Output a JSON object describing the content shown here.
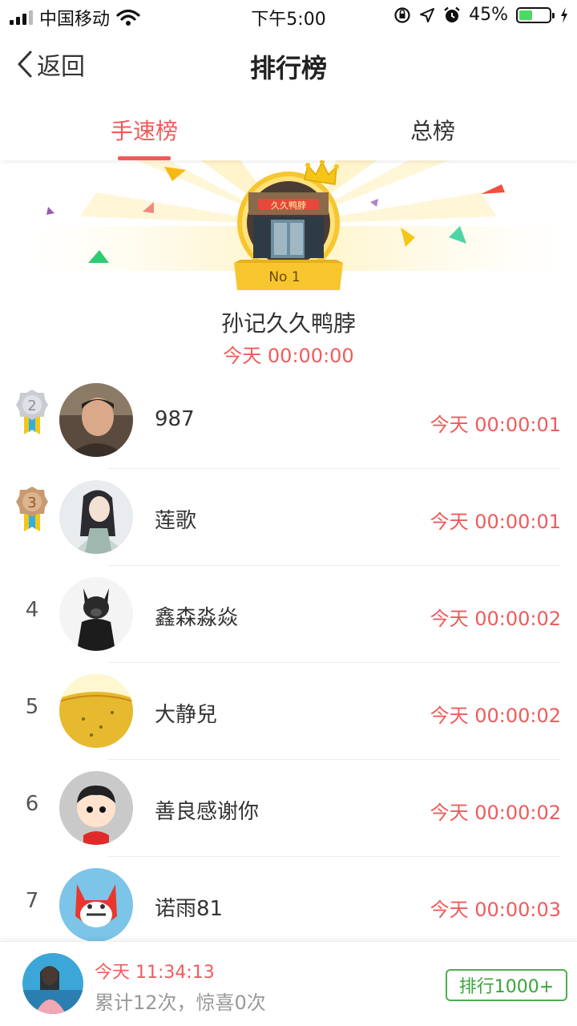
{
  "status_bar": {
    "carrier": "中国移动",
    "time": "下午5:00",
    "battery": "45%",
    "battery_level": 0.45
  },
  "nav": {
    "back_label": "返回",
    "title": "排行榜"
  },
  "tabs": [
    {
      "label": "手速榜",
      "active": true
    },
    {
      "label": "总榜",
      "active": false
    }
  ],
  "champion": {
    "badge": "No 1",
    "shop_sign": "久久鸭脖",
    "name": "孙记久久鸭脖",
    "time": "今天 00:00:00"
  },
  "rankings": [
    {
      "rank": "2",
      "name": "987",
      "time": "今天 00:00:01",
      "medal": "silver"
    },
    {
      "rank": "3",
      "name": "莲歌",
      "time": "今天 00:00:01",
      "medal": "bronze"
    },
    {
      "rank": "4",
      "name": "鑫森淼焱",
      "time": "今天 00:00:02"
    },
    {
      "rank": "5",
      "name": "大静兒",
      "time": "今天 00:00:02"
    },
    {
      "rank": "6",
      "name": "善良感谢你",
      "time": "今天 00:00:02"
    },
    {
      "rank": "7",
      "name": "诺雨81",
      "time": "今天 00:00:03"
    }
  ],
  "me": {
    "time": "今天 11:34:13",
    "stats": "累计12次，惊喜0次",
    "rank_button": "排行1000+"
  },
  "colors": {
    "accent": "#f05b5b",
    "green": "#4cae4c",
    "gold": "#f7c62f"
  }
}
